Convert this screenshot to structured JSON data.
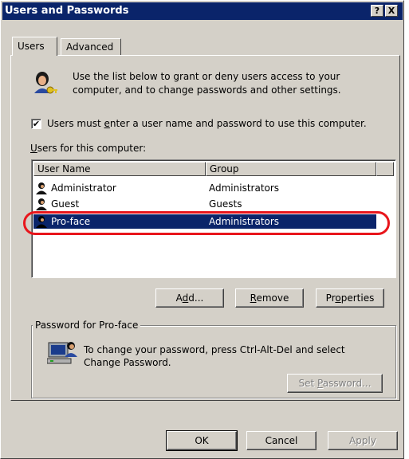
{
  "window": {
    "title": "Users and Passwords",
    "help_glyph": "?",
    "close_glyph": "X"
  },
  "tabs": [
    {
      "label": "Users",
      "active": true
    },
    {
      "label": "Advanced",
      "active": false
    }
  ],
  "intro": {
    "line1": "Use the list below to grant or deny users access to your",
    "line2": "computer, and to change passwords and other settings.",
    "icon": "users-key-icon"
  },
  "require_login": {
    "checked": true,
    "mark": "✔",
    "label_pre": "Users must ",
    "label_access": "e",
    "label_post": "nter a user name and password to use this computer."
  },
  "users_list": {
    "label_access": "U",
    "label_rest": "sers for this computer:",
    "columns": [
      "User Name",
      "Group"
    ],
    "rows": [
      {
        "name": "Administrator",
        "group": "Administrators",
        "selected": false
      },
      {
        "name": "Guest",
        "group": "Guests",
        "selected": false
      },
      {
        "name": "Pro-face",
        "group": "Administrators",
        "selected": true
      }
    ]
  },
  "list_buttons": {
    "add": {
      "pre": "A",
      "access": "d",
      "post": "d..."
    },
    "remove": {
      "pre": "",
      "access": "R",
      "post": "emove"
    },
    "properties": {
      "pre": "Pr",
      "access": "o",
      "post": "perties"
    }
  },
  "password_group": {
    "legend": "Password for Pro-face",
    "line1": "To change your password, press Ctrl-Alt-Del and select",
    "line2": "Change Password.",
    "icon": "computer-user-icon",
    "set_button": {
      "pre": "Set ",
      "access": "P",
      "post": "assword..."
    }
  },
  "footer": {
    "ok": "OK",
    "cancel": "Cancel",
    "apply": "Apply"
  },
  "colors": {
    "title_bar": "#0a246a",
    "selection": "#0a246a",
    "face": "#d4d0c8",
    "annotation": "#e8151b"
  }
}
